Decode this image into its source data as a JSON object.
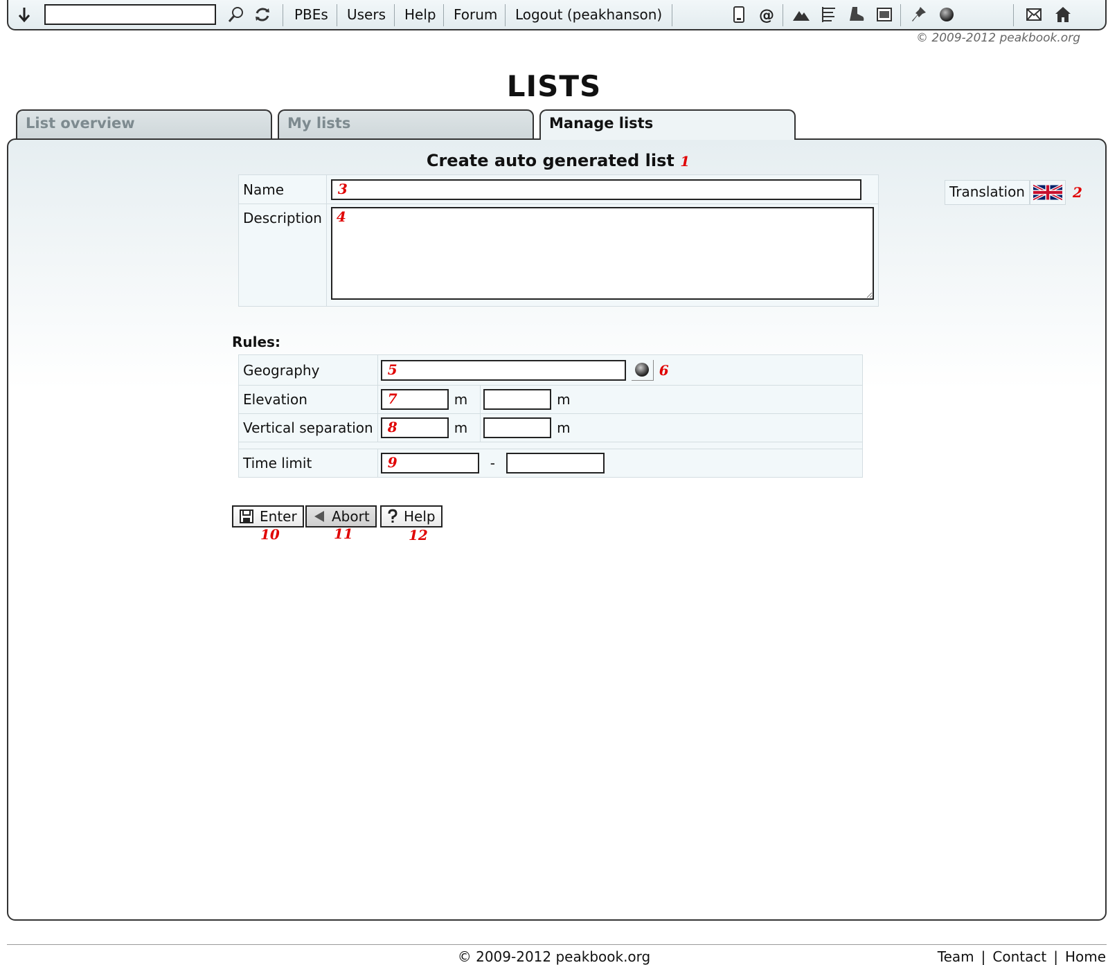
{
  "topbar": {
    "search_value": "",
    "nav": [
      "PBEs",
      "Users",
      "Help",
      "Forum",
      "Logout (peakhanson)"
    ],
    "icons": [
      "down-arrow-icon",
      "search-icon",
      "refresh-icon",
      "phone-icon",
      "at-icon",
      "mountain-icon",
      "list-icon",
      "boot-icon",
      "photo-icon",
      "pin-icon",
      "globe-icon",
      "mail-icon",
      "home-icon"
    ],
    "copyright": "© 2009-2012 peakbook.org"
  },
  "page": {
    "title": "LISTS"
  },
  "tabs": [
    {
      "label": "List overview",
      "active": false
    },
    {
      "label": "My lists",
      "active": false
    },
    {
      "label": "Manage lists",
      "active": true
    }
  ],
  "form": {
    "heading": "Create auto generated list",
    "markers": [
      "1",
      "2",
      "3",
      "4",
      "5",
      "6",
      "7",
      "8",
      "9",
      "10",
      "11",
      "12"
    ],
    "name_label": "Name",
    "description_label": "Description",
    "translation_label": "Translation",
    "rules_label": "Rules:",
    "rules": {
      "geography_label": "Geography",
      "elevation_label": "Elevation",
      "vertical_label": "Vertical separation",
      "time_label": "Time limit",
      "unit": "m",
      "range_sep": "-"
    },
    "buttons": {
      "enter": "Enter",
      "abort": "Abort",
      "help": "Help"
    }
  },
  "footer": {
    "copyright": "© 2009-2012 peakbook.org",
    "links": [
      "Team",
      "Contact",
      "Home"
    ]
  },
  "colors": {
    "marker": "#e00000",
    "panel_bg": "#e6eef1",
    "border": "#333333"
  }
}
